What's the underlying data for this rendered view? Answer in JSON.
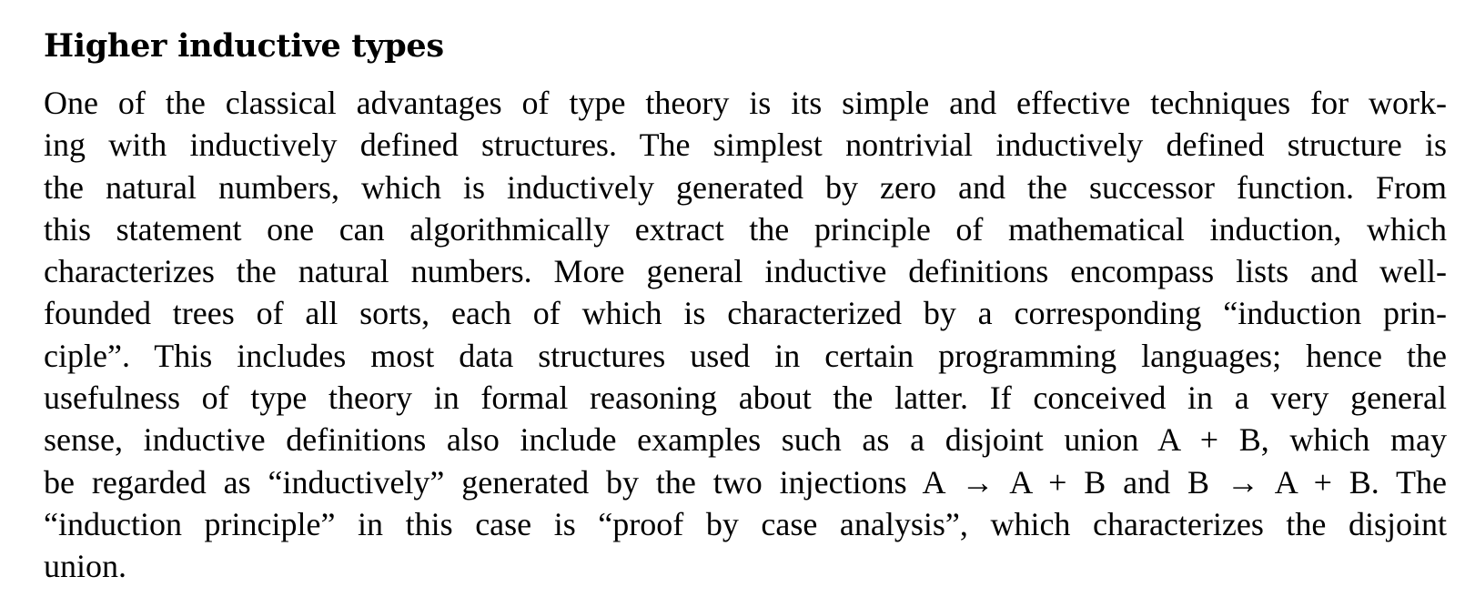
{
  "section": {
    "title": "Higher inductive types",
    "lines": [
      "One of the classical advantages of type theory is its simple and effective techniques for work-",
      "ing with inductively defined structures. The simplest nontrivial inductively defined structure is",
      "the natural numbers, which is inductively generated by zero and the successor function. From",
      "this statement one can algorithmically extract the principle of mathematical induction, which",
      "characterizes the natural numbers. More general inductive definitions encompass lists and well-",
      "founded trees of all sorts, each of which is characterized by a corresponding “induction prin-",
      "ciple”. This includes most data structures used in certain programming languages; hence the",
      "usefulness of type theory in formal reasoning about the latter. If conceived in a very general",
      "sense, inductive definitions also include examples such as a disjoint union A + B, which may",
      "be regarded as “inductively” generated by the two injections A → A + B and B → A + B. The",
      "“induction principle” in this case is “proof by case analysis”, which characterizes the disjoint",
      "union."
    ]
  }
}
